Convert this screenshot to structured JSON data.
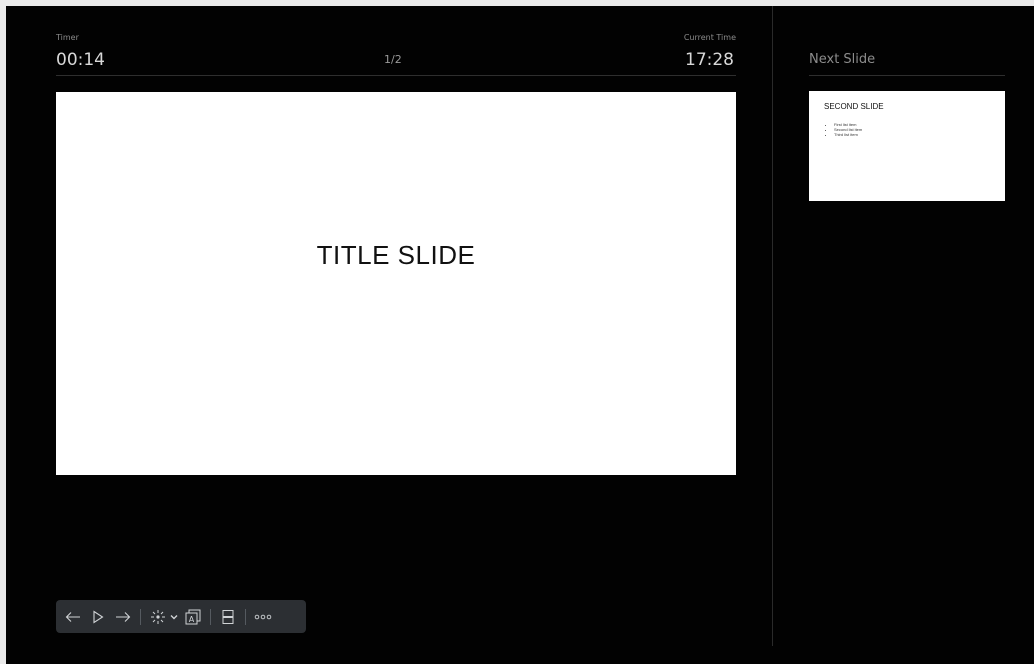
{
  "header": {
    "timer_label": "Timer",
    "timer_value": "00:14",
    "page_counter": "1/2",
    "clock_label": "Current Time",
    "clock_value": "17:28"
  },
  "next_panel": {
    "title": "Next Slide"
  },
  "current_slide": {
    "title": "TITLE SLIDE"
  },
  "next_slide": {
    "title": "SECOND SLIDE",
    "items": [
      "First list item",
      "Second list item",
      "Third list item"
    ]
  },
  "toolbar": {
    "buttons": [
      "arrow-left-icon",
      "play-icon",
      "arrow-right-icon",
      "laser-pointer-icon",
      "chevron-down-icon",
      "slide-notes-icon",
      "layout-icon",
      "more-icon"
    ]
  },
  "colors": {
    "background": "#020202",
    "toolbar": "#2c2f33",
    "slide": "#ffffff"
  }
}
